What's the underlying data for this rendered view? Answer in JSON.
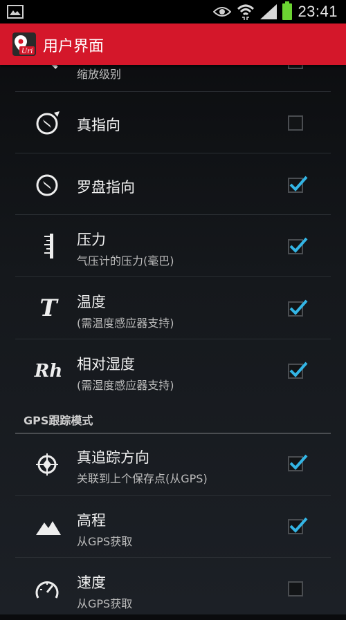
{
  "status_bar": {
    "time": "23:41"
  },
  "action_bar": {
    "title": "用户界面"
  },
  "items_top": [
    {
      "title": "缩放级别",
      "checked": false
    },
    {
      "title": "真指向",
      "checked": false
    },
    {
      "title": "罗盘指向",
      "checked": true
    },
    {
      "title": "压力",
      "subtitle": "气压计的压力(毫巴)",
      "checked": true
    },
    {
      "title": "温度",
      "subtitle": "(需温度感应器支持)",
      "icon_text": "T",
      "checked": true
    },
    {
      "title": "相对湿度",
      "subtitle": "(需湿度感应器支持)",
      "icon_text": "Rh",
      "checked": true
    }
  ],
  "section_gps": {
    "header": "GPS跟踪模式",
    "items": [
      {
        "title": "真追踪方向",
        "subtitle": "关联到上个保存点(从GPS)",
        "checked": true
      },
      {
        "title": "高程",
        "subtitle": "从GPS获取",
        "checked": true
      },
      {
        "title": "速度",
        "subtitle": "从GPS获取",
        "checked": false
      }
    ]
  },
  "colors": {
    "action_bar": "#d4172a",
    "check": "#33b5e5",
    "divider": "#2a2e33"
  }
}
